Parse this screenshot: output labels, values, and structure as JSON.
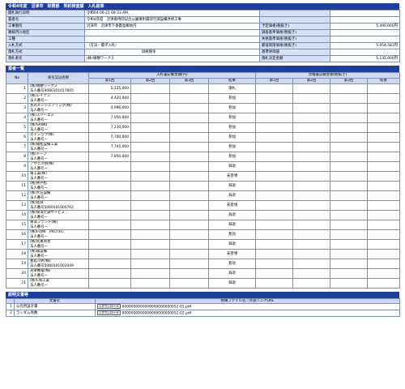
{
  "title": "令和4年度　沼津市　財務部　契約検査課　入札結果",
  "info": [
    {
      "label": "開札執行日時",
      "value": "令和04-06-21 09:33 AM",
      "label2": "",
      "value2": ""
    },
    {
      "label": "業者名",
      "value": "令和4年度　沼津御用邸記念公園東附属邸空調設備改修工事",
      "label2": "",
      "value2": ""
    },
    {
      "label": "工事箇所",
      "value": "沼津市　沼津市下香貫島郷地内",
      "label2": "予定価格(税抜き)",
      "value2": "5,490,000円"
    },
    {
      "label": "路線河川地区",
      "value": "",
      "label2": "調査基準価格(税抜き)",
      "value2": "-"
    },
    {
      "label": "工種",
      "value": "",
      "label2": "失格基準価格(税抜き)",
      "value2": "-"
    },
    {
      "label": "入札方式",
      "value": "（方法：電子入札）",
      "label2": "最低制限価格(税抜き)",
      "value2": "5,054,581円"
    },
    {
      "label": "落札方式",
      "value": "価格競争",
      "label2": "基準評価値",
      "value2": ""
    },
    {
      "label": "落札者名",
      "value": "(株)増穂ワークス",
      "label2": "落札決定金額",
      "value2": "5,135,000円"
    }
  ],
  "bidders_title": "業者一覧",
  "bid_headers": {
    "no": "No",
    "name": "商号又は名称",
    "bid_group": "入札書記載金額(円)",
    "cost_group": "見積書記載金額(税抜き)",
    "r1": "第1回",
    "r2": "第2回",
    "r3": "第3回",
    "result": "結果"
  },
  "bidders": [
    {
      "no": "1",
      "name": "(株)増穂ワークス",
      "corp": "法人番号9080101017605",
      "r1": "5,135,000",
      "result": "落札"
    },
    {
      "no": "2",
      "name": "(株)レイデン",
      "corp": "法人番号ー",
      "r1": "4,420,000",
      "result": "参加"
    },
    {
      "no": "3",
      "name": "永光エンジニアリング(株)",
      "corp": "法人番号ー",
      "r1": "4,996,000",
      "result": "参加"
    },
    {
      "no": "4",
      "name": "(株)スリーエス",
      "corp": "法人番号ー",
      "r1": "7,050,000",
      "result": "参加"
    },
    {
      "no": "5",
      "name": "(株)SANKI",
      "corp": "法人番号ー",
      "r1": "7,230,000",
      "result": "参加"
    },
    {
      "no": "6",
      "name": "エイショウ(株)",
      "corp": "法人番号ー",
      "r1": "7,700,000",
      "result": "参加"
    },
    {
      "no": "7",
      "name": "(株)福松設備工業",
      "corp": "法人番号ー",
      "r1": "7,745,000",
      "result": "参加"
    },
    {
      "no": "8",
      "name": "(株)トーブ",
      "corp": "法人番号ー",
      "r1": "7,850,000",
      "result": "参加"
    },
    {
      "no": "9",
      "name": "アサヒ冷熱(株)",
      "corp": "法人番号ー",
      "r1": "",
      "result": "辞退"
    },
    {
      "no": "10",
      "name": "東工業(株)",
      "corp": "法人番号ー",
      "r1": "",
      "result": "未受領"
    },
    {
      "no": "11",
      "name": "(株)井戸松",
      "corp": "法人番号ー",
      "r1": "",
      "result": "辞退"
    },
    {
      "no": "12",
      "name": "(株)大石設備",
      "corp": "法人番号ー",
      "r1": "",
      "result": "辞退"
    },
    {
      "no": "13",
      "name": "(株)進興",
      "corp": "法人番号5080101000762",
      "r1": "",
      "result": "未受領"
    },
    {
      "no": "14",
      "name": "(株)東海空調サービス",
      "corp": "法人番号ー",
      "r1": "",
      "result": "辞退"
    },
    {
      "no": "15",
      "name": "東海プラント(株)",
      "corp": "法人番号ー",
      "r1": "",
      "result": "辞退"
    },
    {
      "no": "16",
      "name": "(株)FUJIN　PROTEC",
      "corp": "法人番号ー",
      "r1": "",
      "result": "無効"
    },
    {
      "no": "17",
      "name": "(株)丸重商会",
      "corp": "法人番号ー",
      "r1": "",
      "result": "辞退"
    },
    {
      "no": "18",
      "name": "(株)森設備",
      "corp": "法人番号ー",
      "r1": "",
      "result": "未受領"
    },
    {
      "no": "19",
      "name": "豊友冷熱(株)",
      "corp": "法人番号5080101002049",
      "r1": "",
      "result": "無効"
    },
    {
      "no": "20",
      "name": "光栄機電(株)",
      "corp": "法人番号ー",
      "r1": "",
      "result": "辞退"
    },
    {
      "no": "21",
      "name": "(株)C和工業",
      "corp": "法人番号ー",
      "r1": "",
      "result": "辞退"
    }
  ],
  "docs_title": "説明文書等",
  "doc_headers": {
    "name": "文書名",
    "file": "格納ファイル名／外部リンクURL"
  },
  "download_label": "ダウンロード",
  "docs": [
    {
      "no": "1",
      "name": "公売用設計書",
      "file": "0000000000000000000000052-01.pdf"
    },
    {
      "no": "2",
      "name": "ランダム係数",
      "file": "0000000000000000000000052-02.pdf"
    }
  ]
}
